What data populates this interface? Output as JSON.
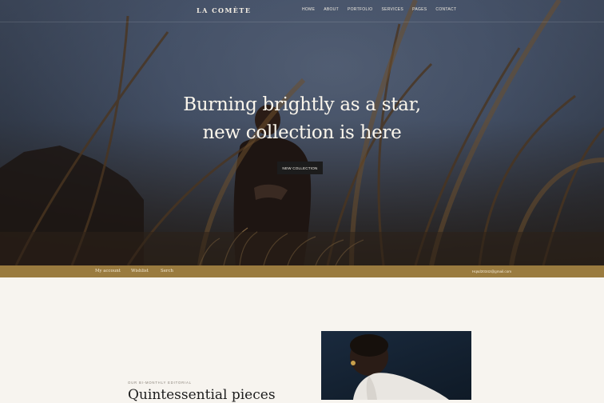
{
  "brand": "LA COMÈTE",
  "nav": {
    "items": [
      "HOME",
      "ABOUT",
      "PORTFOLIO",
      "SERVICES",
      "PAGES",
      "CONTACT"
    ]
  },
  "hero": {
    "headline_line1": "Burning brightly as a star,",
    "headline_line2": "new collection is here",
    "cta_label": "NEW COLLECTION"
  },
  "utility_bar": {
    "links": [
      "My account",
      "Wishlist",
      "Serch"
    ],
    "email": "Hqsd20342@gmail.com",
    "color": "#9a7b3f"
  },
  "editorial": {
    "eyebrow": "OUR BI-MONTHLY EDITORIAL",
    "title": "Quintessential pieces"
  },
  "icons": {
    "hero_image": "woman-in-grass-photo",
    "portrait_image": "woman-portrait-photo"
  }
}
